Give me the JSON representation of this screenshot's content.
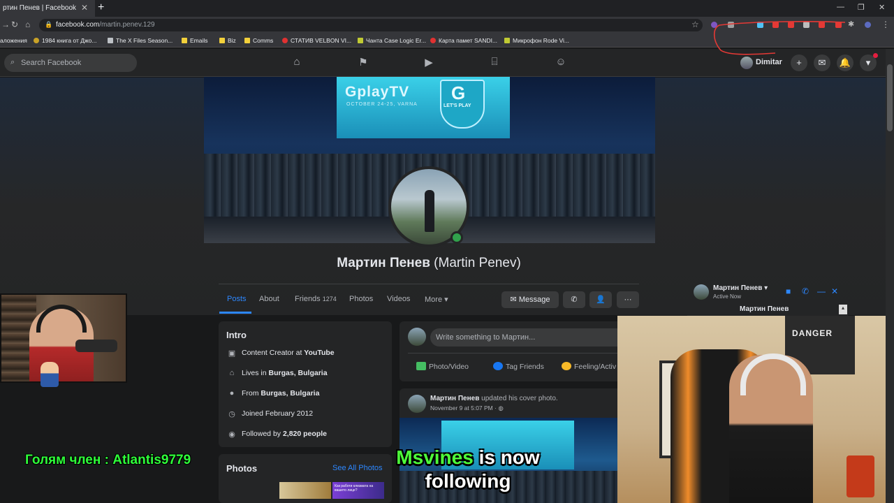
{
  "browser": {
    "tab_title": "ртин Пенев | Facebook",
    "new_tab_symbol": "+",
    "url_host": "facebook.com",
    "url_path": "/martin.penev.129",
    "bookmarks": [
      {
        "label": "аложения",
        "icon": "grid-icon",
        "color": "#5f6368"
      },
      {
        "label": "1984 книга от Джо...",
        "icon": "bookmark-icon",
        "color": "#c9a227"
      },
      {
        "label": "The X Files Season...",
        "icon": "page-icon",
        "color": "#bdc1c6"
      },
      {
        "label": "Emails",
        "icon": "folder-icon",
        "color": "#f2d03b"
      },
      {
        "label": "Biz",
        "icon": "folder-icon",
        "color": "#f2d03b"
      },
      {
        "label": "Comms",
        "icon": "folder-icon",
        "color": "#f2d03b"
      },
      {
        "label": "СТАТИВ VELBON VI...",
        "icon": "emag-icon",
        "color": "#e03131"
      },
      {
        "label": "Чанта Case Logic Er...",
        "icon": "page-icon",
        "color": "#c0ca33"
      },
      {
        "label": "Карта памет SANDI...",
        "icon": "emag-icon",
        "color": "#e03131"
      },
      {
        "label": "Микрофон Rode Vi...",
        "icon": "page-icon",
        "color": "#c0ca33"
      }
    ]
  },
  "facebook": {
    "search_placeholder": "Search Facebook",
    "nav_icons": [
      "home-icon",
      "flag-icon",
      "watch-icon",
      "marketplace-icon",
      "groups-icon"
    ],
    "user_name": "Dimitar",
    "header_buttons": [
      "plus-icon",
      "messenger-icon",
      "bell-icon",
      "dropdown-icon"
    ],
    "accent_color": "#2d88ff",
    "profile": {
      "cover_brand": "GplayTV",
      "cover_date": "OCTOBER 24-25, VARNA",
      "cover_logo_letter": "G",
      "cover_logo_tag": "LET'S PLAY",
      "name": "Мартин Пенев",
      "alt_name": "(Martin Penev)",
      "tabs": [
        {
          "label": "Posts",
          "count": ""
        },
        {
          "label": "About",
          "count": ""
        },
        {
          "label": "Friends",
          "count": "1274"
        },
        {
          "label": "Photos",
          "count": ""
        },
        {
          "label": "Videos",
          "count": ""
        },
        {
          "label": "More",
          "count": ""
        }
      ],
      "message_button": "Message"
    },
    "intro": {
      "title": "Intro",
      "items": [
        {
          "icon": "briefcase-icon",
          "prefix": "Content Creator at ",
          "bold": "YouTube"
        },
        {
          "icon": "home-icon",
          "prefix": "Lives in ",
          "bold": "Burgas, Bulgaria"
        },
        {
          "icon": "location-icon",
          "prefix": "From ",
          "bold": "Burgas, Bulgaria"
        },
        {
          "icon": "clock-icon",
          "prefix": "Joined February 2012",
          "bold": ""
        },
        {
          "icon": "rss-icon",
          "prefix": "Followed by ",
          "bold": "2,820 people"
        }
      ]
    },
    "photos": {
      "title": "Photos",
      "see_all": "See All Photos",
      "thumb_text": "Как работи клизмата на вашето лице?"
    },
    "composer": {
      "placeholder": "Write something to Мартин...",
      "actions": [
        "Photo/Video",
        "Tag Friends",
        "Feeling/Activ"
      ]
    },
    "post": {
      "author": "Мартин Пенев",
      "action": " updated his cover photo.",
      "time": "November 9 at 5:07 PM · "
    },
    "chat": {
      "name": "Мартин Пенев",
      "status": "Active Now",
      "title": "Мартин Пенев"
    }
  },
  "stream": {
    "chat_message": "Голям член : Atlantis9779",
    "follow_user": "Msvines",
    "follow_text_1": " is now",
    "follow_text_2": "following",
    "poster_text": "DANGER"
  }
}
